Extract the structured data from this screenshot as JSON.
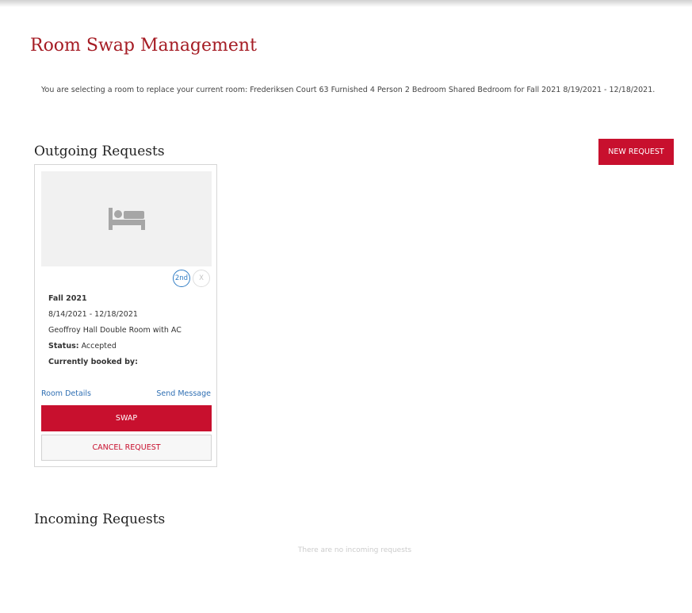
{
  "page": {
    "title": "Room Swap Management",
    "intro": "You are selecting a room to replace your current room: Frederiksen Court 63 Furnished 4 Person 2 Bedroom Shared Bedroom for Fall 2021 8/19/2021 - 12/18/2021.",
    "accent_color": "#c8102e",
    "title_color": "#a51c24",
    "link_color": "#2f6fb3"
  },
  "outgoing": {
    "title": "Outgoing Requests",
    "new_request_label": "NEW REQUEST",
    "requests": [
      {
        "image_icon": "bed-icon",
        "rank_label": "2nd",
        "remove_label": "X",
        "term": "Fall 2021",
        "dates": "8/14/2021 - 12/18/2021",
        "room": "Geoffroy Hall Double Room with AC",
        "status_label": "Status:",
        "status_value": "Accepted",
        "booked_by_label": "Currently booked by:",
        "room_details_label": "Room Details",
        "send_message_label": "Send Message",
        "swap_label": "SWAP",
        "cancel_label": "CANCEL REQUEST"
      }
    ]
  },
  "incoming": {
    "title": "Incoming Requests",
    "empty_message": "There are no incoming requests"
  }
}
